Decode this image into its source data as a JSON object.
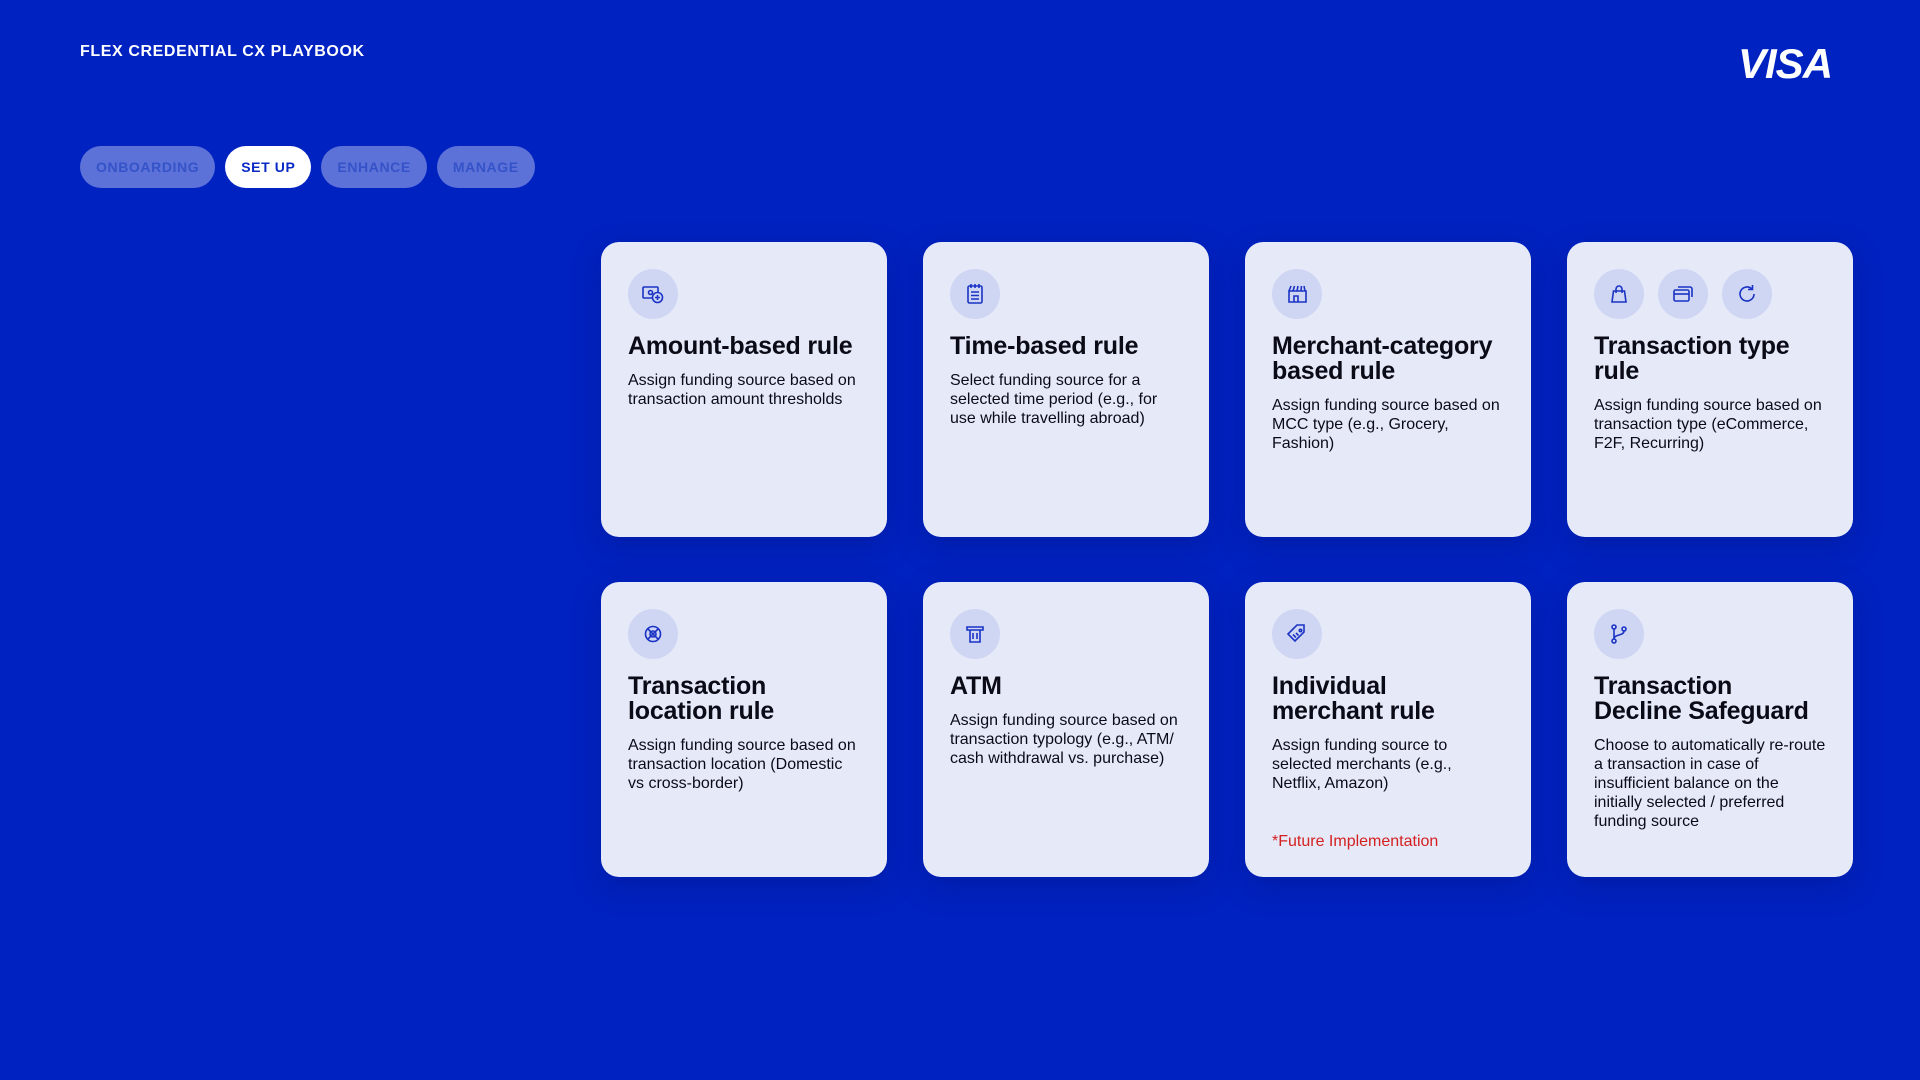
{
  "header": {
    "title": "FLEX CREDENTIAL CX PLAYBOOK",
    "logo_text": "VISA"
  },
  "tabs": [
    {
      "label": "ONBOARDING",
      "active": false
    },
    {
      "label": "SET UP",
      "active": true
    },
    {
      "label": "ENHANCE",
      "active": false
    },
    {
      "label": "MANAGE",
      "active": false
    }
  ],
  "cards": [
    {
      "icons": [
        "amount-money-icon"
      ],
      "title": "Amount-based rule",
      "description": "Assign funding source based on transaction amount thresholds",
      "note": ""
    },
    {
      "icons": [
        "calendar-icon"
      ],
      "title": "Time-based rule",
      "description": "Select funding source for a selected time period (e.g., for use while travelling abroad)",
      "note": ""
    },
    {
      "icons": [
        "storefront-icon"
      ],
      "title": "Merchant-category based rule",
      "description": "Assign funding source based on MCC type (e.g., Grocery, Fashion)",
      "note": ""
    },
    {
      "icons": [
        "shopping-bag-icon",
        "card-icon",
        "refresh-icon"
      ],
      "title": "Transaction type rule",
      "description": "Assign funding source based on transaction type (eCommerce, F2F, Recurring)",
      "note": ""
    },
    {
      "icons": [
        "location-icon"
      ],
      "title": "Transaction location rule",
      "description": "Assign funding source based on transaction location (Domestic vs cross-border)",
      "note": ""
    },
    {
      "icons": [
        "atm-icon"
      ],
      "title": "ATM",
      "description": "Assign funding source based on transaction typology (e.g., ATM/ cash withdrawal vs. purchase)",
      "note": ""
    },
    {
      "icons": [
        "tag-icon"
      ],
      "title": "Individual merchant rule",
      "description": "Assign funding source to selected merchants (e.g., Netflix, Amazon)",
      "note": "*Future Implementation"
    },
    {
      "icons": [
        "branch-icon"
      ],
      "title": "Transaction Decline Safeguard",
      "description": "Choose to automatically re-route a transaction in case of insufficient balance on the initially selected / preferred funding source",
      "note": ""
    }
  ],
  "colors": {
    "background": "#0022c0",
    "card": "#e6e9f8",
    "icon_stroke": "#1a33c4",
    "note": "#d52020"
  }
}
